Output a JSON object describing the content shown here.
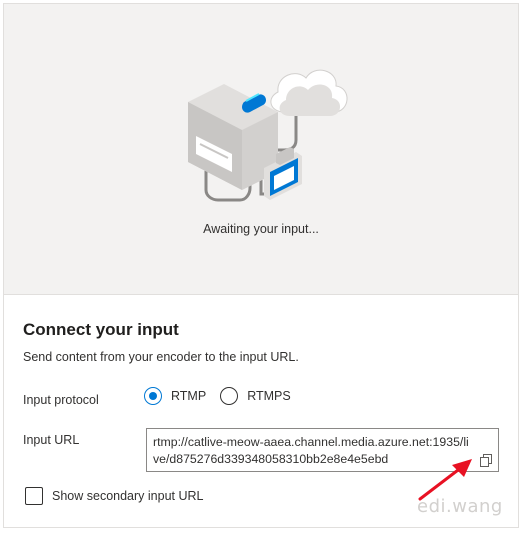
{
  "preview": {
    "status_text": "Awaiting your input..."
  },
  "section": {
    "title": "Connect your input",
    "description": "Send content from your encoder to the input URL."
  },
  "protocol": {
    "label": "Input protocol",
    "options": [
      {
        "label": "RTMP",
        "selected": true
      },
      {
        "label": "RTMPS",
        "selected": false
      }
    ]
  },
  "input_url": {
    "label": "Input URL",
    "value": "rtmp://catlive-meow-aaea.channel.media.azure.net:1935/live/d875276d339348058310bb2e8e4e5ebd",
    "copy_icon": "copy-icon"
  },
  "secondary": {
    "label": "Show secondary input URL",
    "checked": false
  },
  "watermark": "edi.wang",
  "colors": {
    "accent": "#0078d4",
    "annotation_arrow": "#e81123",
    "preview_bg": "#f3f2f1"
  }
}
